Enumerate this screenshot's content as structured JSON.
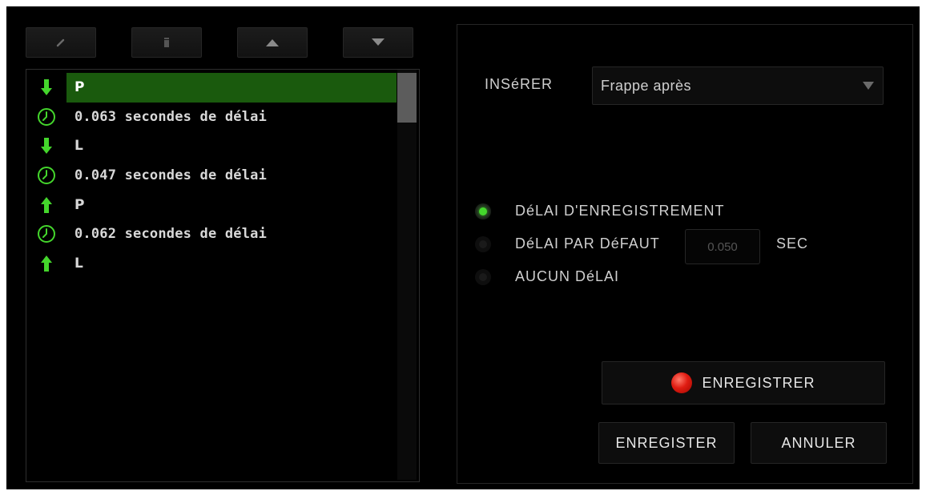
{
  "toolbar": {
    "buttons": [
      {
        "icon": "pencil-icon"
      },
      {
        "icon": "trash-icon"
      },
      {
        "icon": "arrow-up-icon"
      },
      {
        "icon": "arrow-down-icon"
      }
    ]
  },
  "macro_list": {
    "items": [
      {
        "type": "key-down",
        "icon": "key-down-arrow-icon",
        "label": "P",
        "selected": true
      },
      {
        "type": "delay",
        "icon": "clock-icon",
        "label": "0.063 secondes de délai"
      },
      {
        "type": "key-down",
        "icon": "key-down-arrow-icon",
        "label": "L"
      },
      {
        "type": "delay",
        "icon": "clock-icon",
        "label": "0.047 secondes de délai"
      },
      {
        "type": "key-up",
        "icon": "key-up-arrow-icon",
        "label": "P"
      },
      {
        "type": "delay",
        "icon": "clock-icon",
        "label": "0.062 secondes de délai"
      },
      {
        "type": "key-up",
        "icon": "key-up-arrow-icon",
        "label": "L"
      }
    ]
  },
  "insert": {
    "label": "INSéRER",
    "selected": "Frappe après"
  },
  "delay_options": {
    "record_delay": "DéLAI D'ENREGISTREMENT",
    "default_delay": "DéLAI PAR DéFAUT",
    "default_delay_value": "0.050",
    "unit": "SEC",
    "no_delay": "AUCUN DéLAI",
    "selected": "record_delay"
  },
  "buttons": {
    "record": "ENREGISTRER",
    "save": "ENREGISTER",
    "cancel": "ANNULER"
  },
  "colors": {
    "accent": "#44d62c",
    "selected_row": "#1a5a0d",
    "record_red": "#e01c12"
  }
}
